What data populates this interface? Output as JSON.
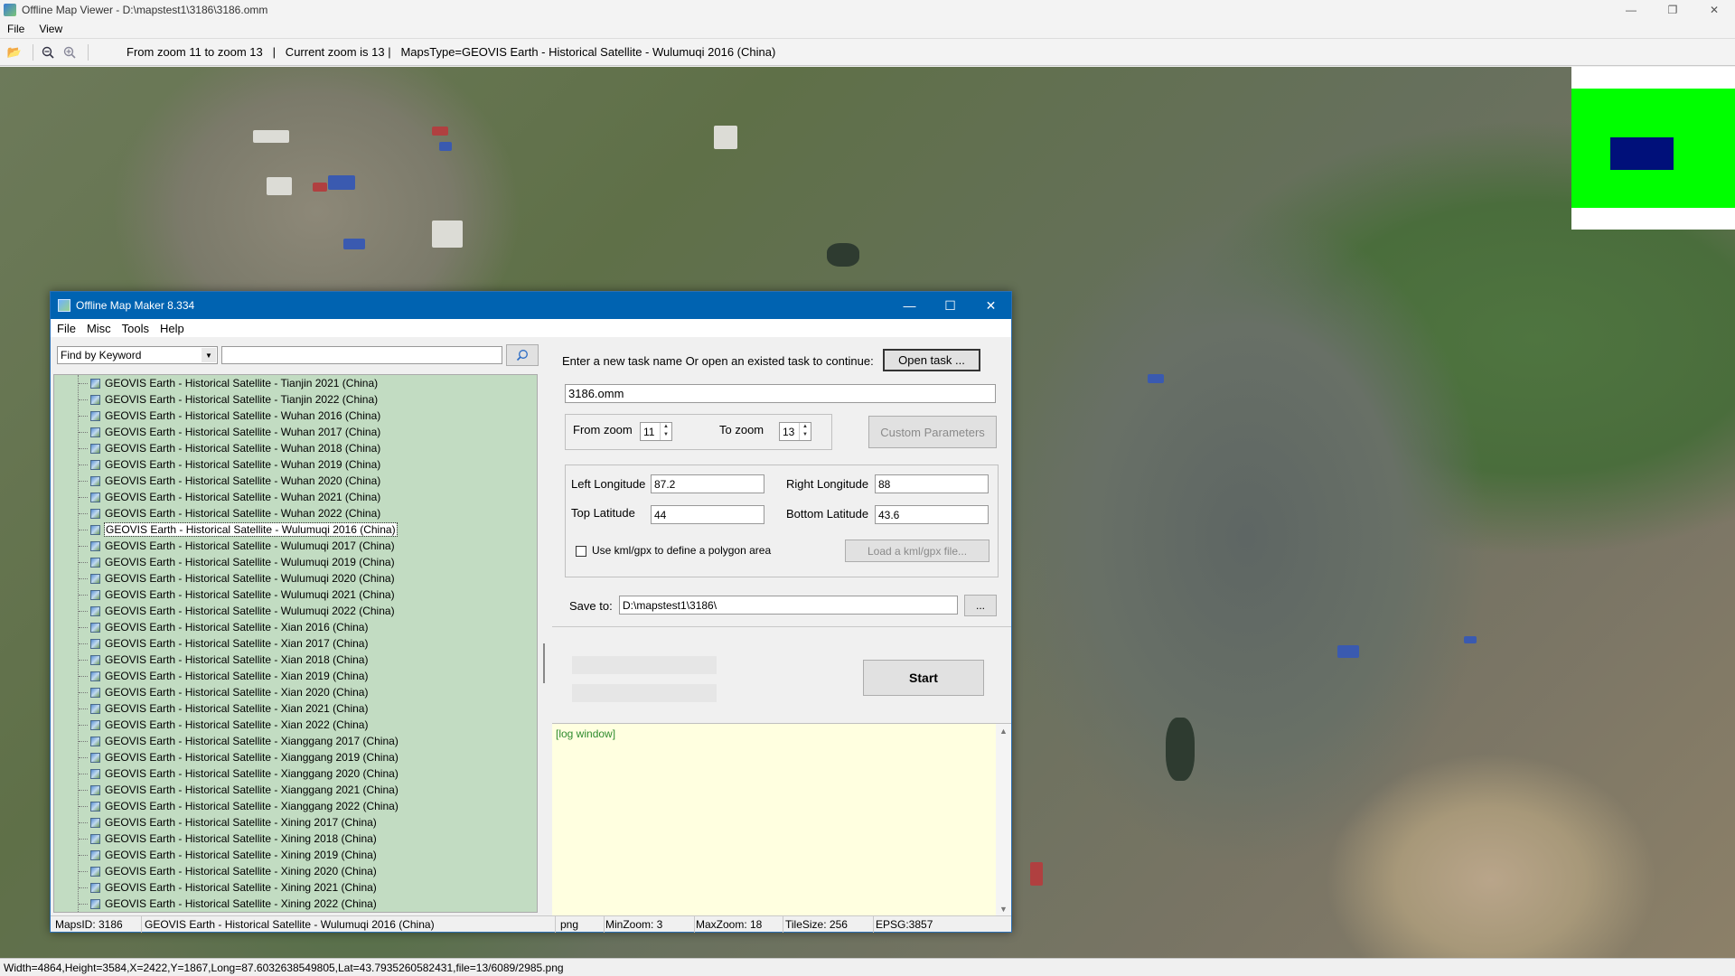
{
  "viewer": {
    "title": "Offline Map Viewer - D:\\mapstest1\\3186\\3186.omm",
    "menu": [
      "File",
      "View"
    ],
    "info_text": "From zoom 11 to zoom 13   |   Current zoom is 13 |   MapsType=GEOVIS Earth - Historical Satellite - Wulumuqi 2016 (China)",
    "status_text": "Width=4864,Height=3584,X=2422,Y=1867,Long=87.6032638549805,Lat=43.7935260582431,file=13/6089/2985.png",
    "window_controls": {
      "minimize": "—",
      "restore": "❐",
      "close": "✕"
    }
  },
  "maker": {
    "title": "Offline Map Maker 8.334",
    "menu": [
      "File",
      "Misc",
      "Tools",
      "Help"
    ],
    "window_controls": {
      "minimize": "—",
      "maximize": "☐",
      "close": "✕"
    },
    "find": {
      "mode": "Find by Keyword",
      "value": ""
    },
    "tree_items": [
      {
        "label": "GEOVIS Earth - Historical Satellite - Tianjin 2021 (China)"
      },
      {
        "label": "GEOVIS Earth - Historical Satellite - Tianjin 2022 (China)"
      },
      {
        "label": "GEOVIS Earth - Historical Satellite - Wuhan 2016 (China)"
      },
      {
        "label": "GEOVIS Earth - Historical Satellite - Wuhan 2017 (China)"
      },
      {
        "label": "GEOVIS Earth - Historical Satellite - Wuhan 2018 (China)"
      },
      {
        "label": "GEOVIS Earth - Historical Satellite - Wuhan 2019 (China)"
      },
      {
        "label": "GEOVIS Earth - Historical Satellite - Wuhan 2020 (China)"
      },
      {
        "label": "GEOVIS Earth - Historical Satellite - Wuhan 2021 (China)"
      },
      {
        "label": "GEOVIS Earth - Historical Satellite - Wuhan 2022 (China)"
      },
      {
        "label": "GEOVIS Earth - Historical Satellite - Wulumuqi 2016 (China)",
        "selected": true
      },
      {
        "label": "GEOVIS Earth - Historical Satellite - Wulumuqi 2017 (China)"
      },
      {
        "label": "GEOVIS Earth - Historical Satellite - Wulumuqi 2019 (China)"
      },
      {
        "label": "GEOVIS Earth - Historical Satellite - Wulumuqi 2020 (China)"
      },
      {
        "label": "GEOVIS Earth - Historical Satellite - Wulumuqi 2021 (China)"
      },
      {
        "label": "GEOVIS Earth - Historical Satellite - Wulumuqi 2022 (China)"
      },
      {
        "label": "GEOVIS Earth - Historical Satellite - Xian 2016 (China)"
      },
      {
        "label": "GEOVIS Earth - Historical Satellite - Xian 2017 (China)"
      },
      {
        "label": "GEOVIS Earth - Historical Satellite - Xian 2018 (China)"
      },
      {
        "label": "GEOVIS Earth - Historical Satellite - Xian 2019 (China)"
      },
      {
        "label": "GEOVIS Earth - Historical Satellite - Xian 2020 (China)"
      },
      {
        "label": "GEOVIS Earth - Historical Satellite - Xian 2021 (China)"
      },
      {
        "label": "GEOVIS Earth - Historical Satellite - Xian 2022 (China)"
      },
      {
        "label": "GEOVIS Earth - Historical Satellite - Xianggang 2017 (China)"
      },
      {
        "label": "GEOVIS Earth - Historical Satellite - Xianggang 2019 (China)"
      },
      {
        "label": "GEOVIS Earth - Historical Satellite - Xianggang 2020 (China)"
      },
      {
        "label": "GEOVIS Earth - Historical Satellite - Xianggang 2021 (China)"
      },
      {
        "label": "GEOVIS Earth - Historical Satellite - Xianggang 2022 (China)"
      },
      {
        "label": "GEOVIS Earth - Historical Satellite - Xining 2017 (China)"
      },
      {
        "label": "GEOVIS Earth - Historical Satellite - Xining 2018 (China)"
      },
      {
        "label": "GEOVIS Earth - Historical Satellite - Xining 2019 (China)"
      },
      {
        "label": "GEOVIS Earth - Historical Satellite - Xining 2020 (China)"
      },
      {
        "label": "GEOVIS Earth - Historical Satellite - Xining 2021 (China)"
      },
      {
        "label": "GEOVIS Earth - Historical Satellite - Xining 2022 (China)"
      }
    ],
    "task": {
      "prompt": "Enter a new task name Or open an existed task to continue:",
      "open_button": "Open task ...",
      "name": "3186.omm"
    },
    "zoom": {
      "from_label": "From zoom",
      "from_value": "11",
      "to_label": "To zoom",
      "to_value": "13",
      "custom_button": "Custom Parameters"
    },
    "bounds": {
      "left_label": "Left Longitude",
      "left_value": "87.2",
      "right_label": "Right Longitude",
      "right_value": "88",
      "top_label": "Top Latitude",
      "top_value": "44",
      "bottom_label": "Bottom Latitude",
      "bottom_value": "43.6",
      "kml_checkbox_label": "Use kml/gpx to define a polygon area",
      "kml_checked": false,
      "kml_button": "Load a kml/gpx file..."
    },
    "save": {
      "label": "Save to:",
      "path": "D:\\mapstest1\\3186\\",
      "browse_button": "..."
    },
    "start_button": "Start",
    "log_text": "[log window]",
    "status": {
      "maps_id": "MapsID: 3186",
      "maps_name": "GEOVIS Earth - Historical Satellite - Wulumuqi 2016 (China)",
      "format": "png",
      "min_zoom": "MinZoom: 3",
      "max_zoom": "MaxZoom: 18",
      "tile_size": "TileSize: 256",
      "epsg": "EPSG:3857"
    }
  },
  "colors": {
    "maker_titlebar": "#0063b1",
    "tree_background": "#c2dcc2",
    "log_background": "#ffffe0",
    "log_text": "#2e8b2e",
    "overview_area": "#00ff00",
    "overview_viewport": "#00107a"
  },
  "icons": {
    "open": "folder-open-icon",
    "zoom_out": "zoom-out-icon",
    "zoom_in": "zoom-in-icon",
    "search": "search-icon",
    "map_item": "map-layer-icon"
  }
}
